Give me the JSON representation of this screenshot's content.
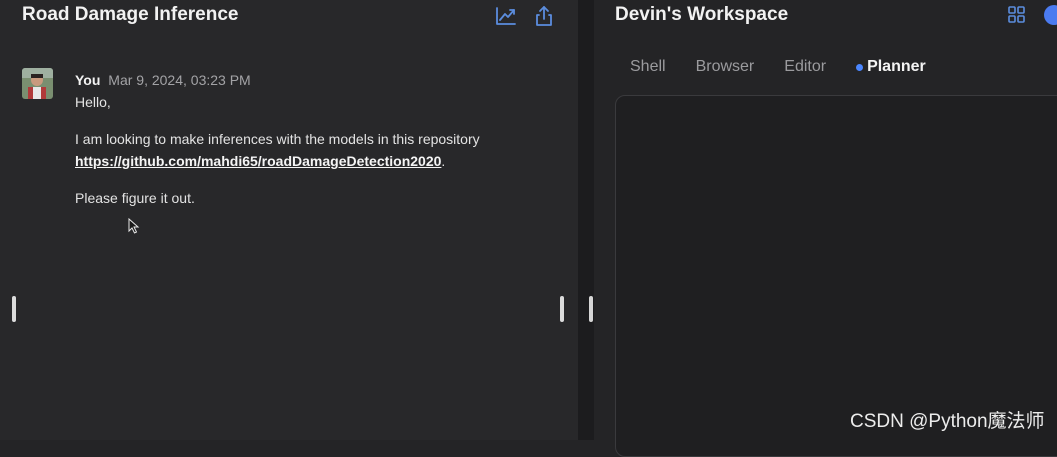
{
  "left": {
    "title": "Road Damage Inference",
    "message": {
      "author": "You",
      "timestamp": "Mar 9, 2024, 03:23 PM",
      "greeting": "Hello,",
      "body": "I am looking to make inferences with the models in this repository",
      "link": "https://github.com/mahdi65/roadDamageDetection2020",
      "link_suffix": ".",
      "closing": "Please figure it out."
    },
    "icons": [
      "chart-line-icon",
      "share-icon"
    ]
  },
  "right": {
    "title": "Devin's Workspace",
    "tabs": [
      {
        "label": "Shell",
        "active": false
      },
      {
        "label": "Browser",
        "active": false
      },
      {
        "label": "Editor",
        "active": false
      },
      {
        "label": "Planner",
        "active": true
      }
    ],
    "icons": [
      "grid-icon",
      "toggle-icon"
    ]
  },
  "watermark": "CSDN @Python魔法师",
  "colors": {
    "background": "#242426",
    "accent": "#4a86ff",
    "icon_blue": "#5b8dde"
  }
}
